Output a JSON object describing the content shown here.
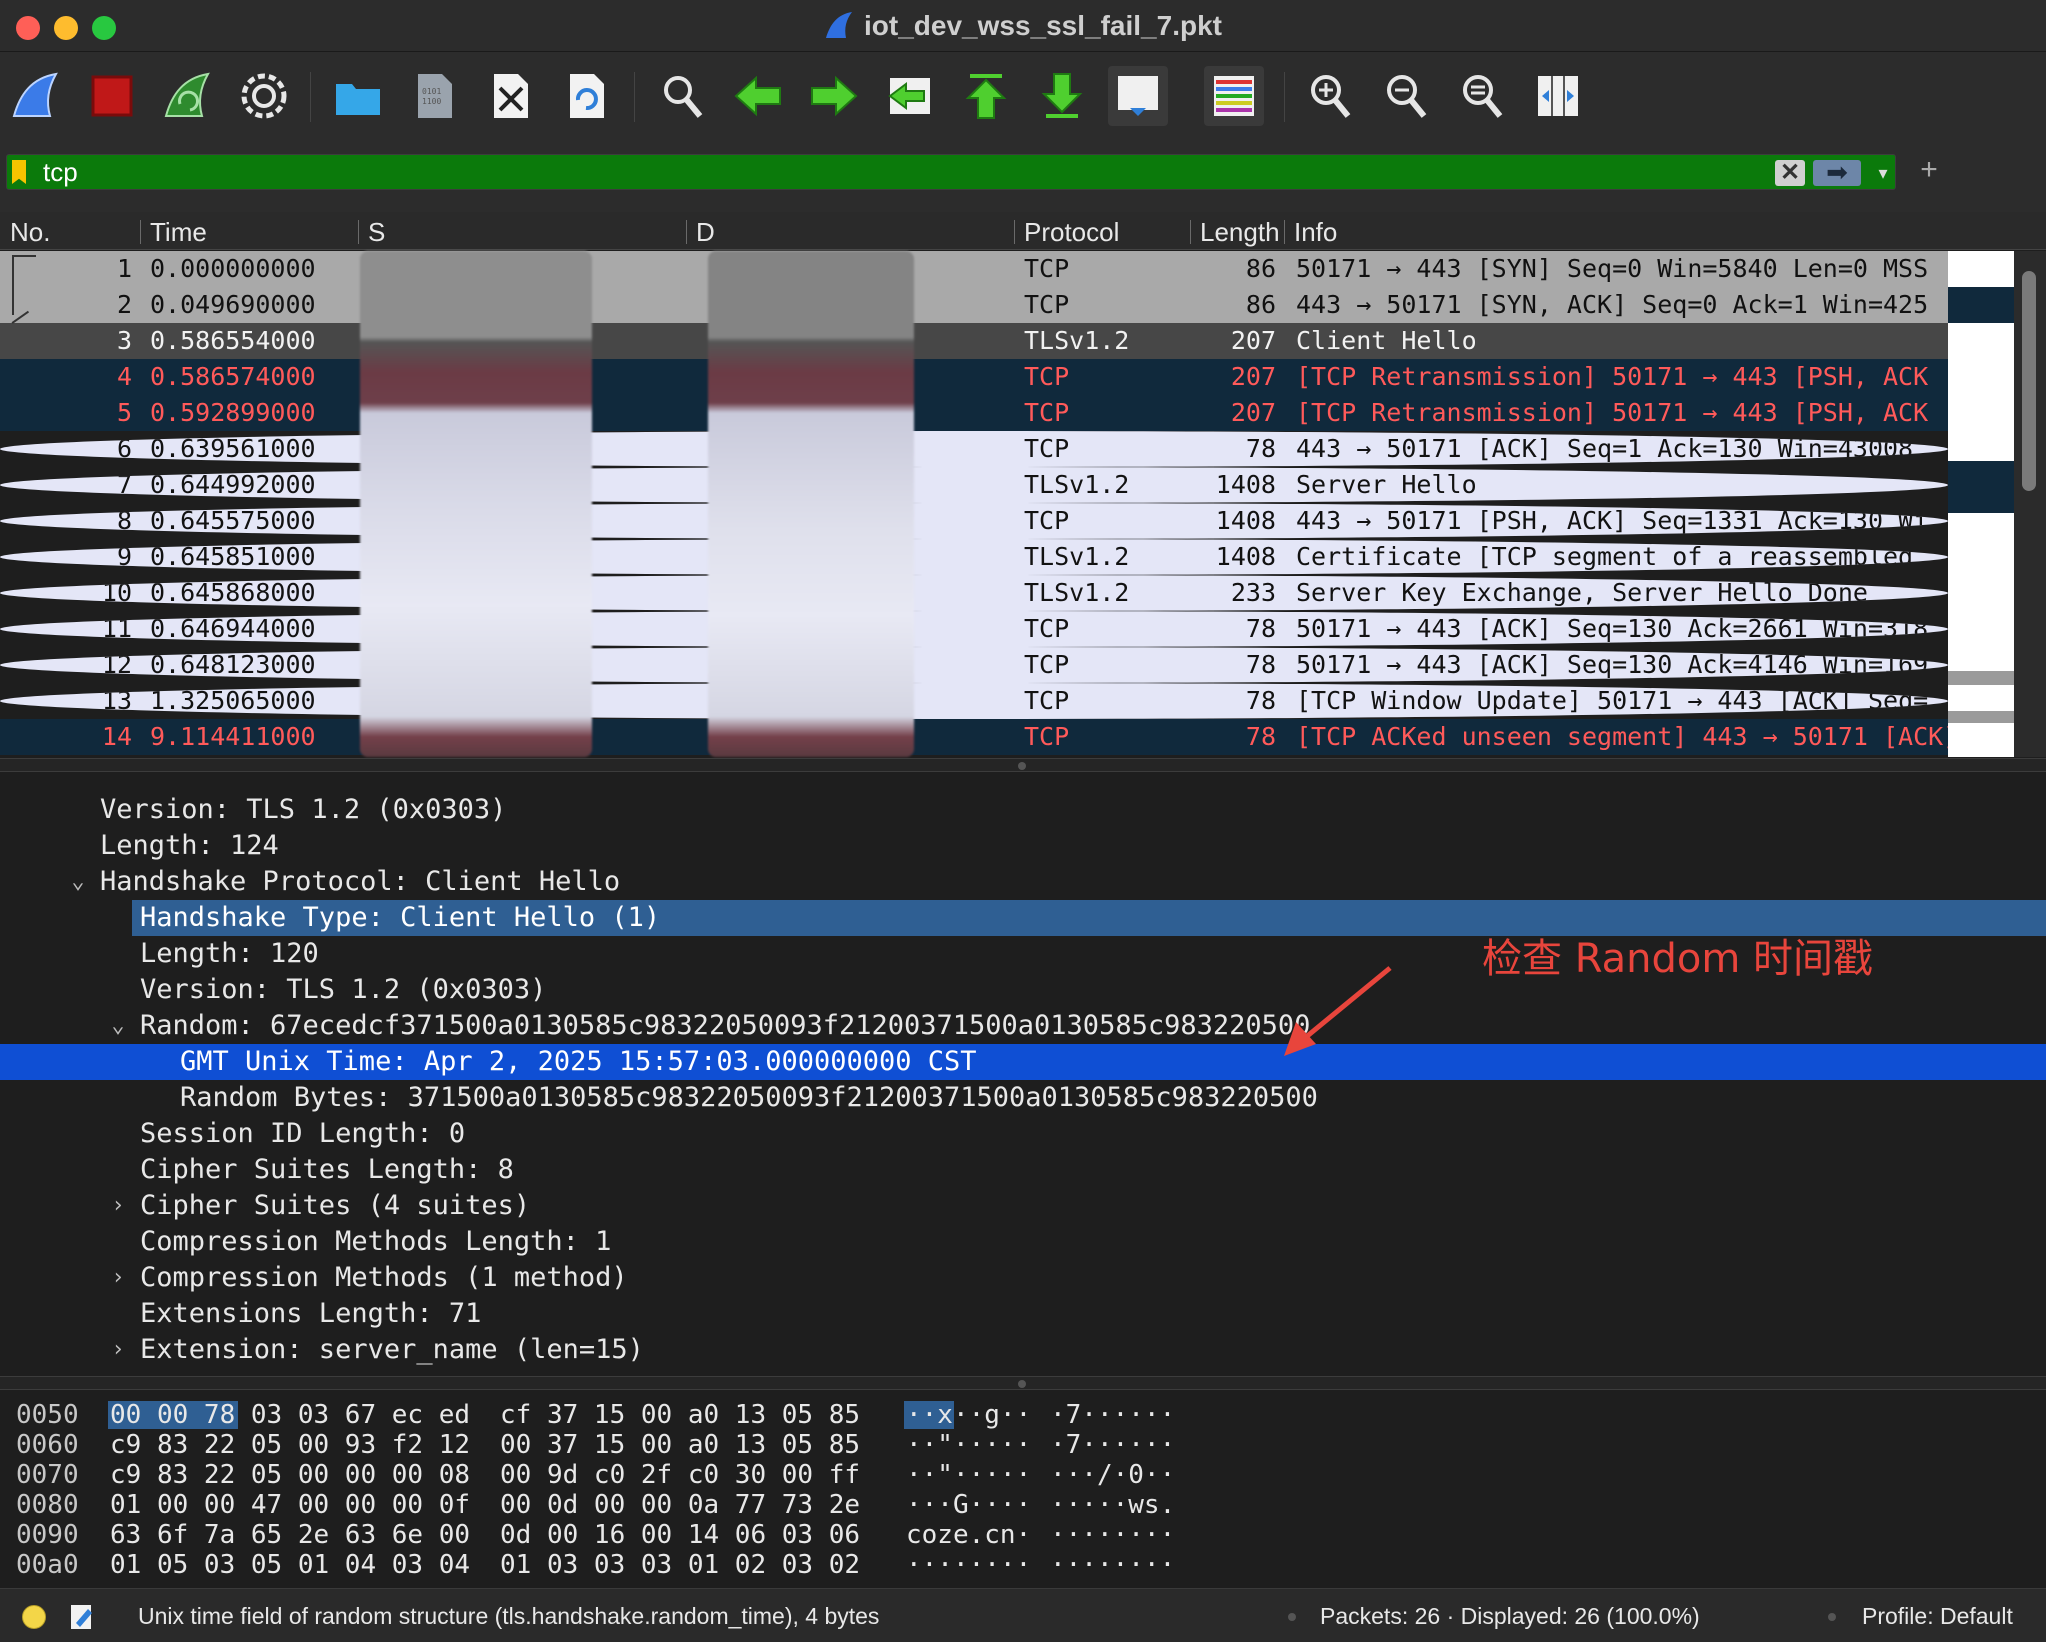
{
  "window": {
    "title": "iot_dev_wss_ssl_fail_7.pkt"
  },
  "toolbar": {
    "buttons": [
      "start-capture",
      "stop-capture",
      "restart-capture",
      "capture-options",
      "open-file",
      "save-file",
      "close-file",
      "reload-file",
      "find-packet",
      "go-back",
      "go-forward",
      "go-to-packet",
      "go-first",
      "go-last",
      "autoscroll",
      "colorize",
      "zoom-in",
      "zoom-out",
      "zoom-normal",
      "resize-columns"
    ]
  },
  "filter": {
    "value": "tcp",
    "bar_color": "#0b7a0b",
    "clear_glyph": "✕",
    "apply_glyph": "➡",
    "dropdown_glyph": "▾",
    "add_glyph": "+"
  },
  "packet_list": {
    "columns": [
      "No.",
      "Time",
      "S",
      "D",
      "Protocol",
      "Length",
      "Info"
    ],
    "rows": [
      {
        "no": "1",
        "time": "0.000000000",
        "protocol": "TCP",
        "length": "86",
        "info": "50171 → 443 [SYN] Seq=0 Win=5840 Len=0 MSS",
        "style": "gray"
      },
      {
        "no": "2",
        "time": "0.049690000",
        "protocol": "TCP",
        "length": "86",
        "info": "443 → 50171 [SYN, ACK] Seq=0 Ack=1 Win=425",
        "style": "gray"
      },
      {
        "no": "3",
        "time": "0.586554000",
        "protocol": "TLSv1.2",
        "length": "207",
        "info": "Client Hello",
        "style": "sel"
      },
      {
        "no": "4",
        "time": "0.586574000",
        "protocol": "TCP",
        "length": "207",
        "info": "[TCP Retransmission] 50171 → 443 [PSH, ACK",
        "style": "dark"
      },
      {
        "no": "5",
        "time": "0.592899000",
        "protocol": "TCP",
        "length": "207",
        "info": "[TCP Retransmission] 50171 → 443 [PSH, ACK",
        "style": "dark"
      },
      {
        "no": "6",
        "time": "0.639561000",
        "protocol": "TCP",
        "length": "78",
        "info": "443 → 50171 [ACK] Seq=1 Ack=130 Win=43008",
        "style": "light"
      },
      {
        "no": "7",
        "time": "0.644992000",
        "protocol": "TLSv1.2",
        "length": "1408",
        "info": "Server Hello",
        "style": "light"
      },
      {
        "no": "8",
        "time": "0.645575000",
        "protocol": "TCP",
        "length": "1408",
        "info": "443 → 50171 [PSH, ACK] Seq=1331 Ack=130 Wi",
        "style": "light"
      },
      {
        "no": "9",
        "time": "0.645851000",
        "protocol": "TLSv1.2",
        "length": "1408",
        "info": "Certificate [TCP segment of a reassembled",
        "style": "light"
      },
      {
        "no": "10",
        "time": "0.645868000",
        "protocol": "TLSv1.2",
        "length": "233",
        "info": "Server Key Exchange, Server Hello Done",
        "style": "light"
      },
      {
        "no": "11",
        "time": "0.646944000",
        "protocol": "TCP",
        "length": "78",
        "info": "50171 → 443 [ACK] Seq=130 Ack=2661 Win=318",
        "style": "light"
      },
      {
        "no": "12",
        "time": "0.648123000",
        "protocol": "TCP",
        "length": "78",
        "info": "50171 → 443 [ACK] Seq=130 Ack=4146 Win=169",
        "style": "light"
      },
      {
        "no": "13",
        "time": "1.325065000",
        "protocol": "TCP",
        "length": "78",
        "info": "[TCP Window Update] 50171 → 443 [ACK] Seq=",
        "style": "light"
      },
      {
        "no": "14",
        "time": "9.114411000",
        "protocol": "TCP",
        "length": "78",
        "info": "[TCP ACKed unseen segment] 443 → 50171 [ACK] Seq",
        "style": "dark"
      }
    ]
  },
  "details": {
    "rows": [
      {
        "indent": 0,
        "twisty": "",
        "text": "Version: TLS 1.2 (0x0303)",
        "style": ""
      },
      {
        "indent": 0,
        "twisty": "",
        "text": "Length: 124",
        "style": ""
      },
      {
        "indent": 0,
        "twisty": "⌄",
        "text": "Handshake Protocol: Client Hello",
        "style": ""
      },
      {
        "indent": 1,
        "twisty": "",
        "text": "Handshake Type: Client Hello (1)",
        "style": "hl"
      },
      {
        "indent": 1,
        "twisty": "",
        "text": "Length: 120",
        "style": ""
      },
      {
        "indent": 1,
        "twisty": "",
        "text": "Version: TLS 1.2 (0x0303)",
        "style": ""
      },
      {
        "indent": 1,
        "twisty": "⌄",
        "text": "Random: 67ecedcf371500a0130585c98322050093f21200371500a0130585c983220500",
        "style": ""
      },
      {
        "indent": 2,
        "twisty": "",
        "text": "GMT Unix Time: Apr  2, 2025 15:57:03.000000000 CST",
        "style": "focus"
      },
      {
        "indent": 2,
        "twisty": "",
        "text": "Random Bytes: 371500a0130585c98322050093f21200371500a0130585c983220500",
        "style": ""
      },
      {
        "indent": 1,
        "twisty": "",
        "text": "Session ID Length: 0",
        "style": ""
      },
      {
        "indent": 1,
        "twisty": "",
        "text": "Cipher Suites Length: 8",
        "style": ""
      },
      {
        "indent": 1,
        "twisty": "›",
        "text": "Cipher Suites (4 suites)",
        "style": ""
      },
      {
        "indent": 1,
        "twisty": "",
        "text": "Compression Methods Length: 1",
        "style": ""
      },
      {
        "indent": 1,
        "twisty": "›",
        "text": "Compression Methods (1 method)",
        "style": ""
      },
      {
        "indent": 1,
        "twisty": "",
        "text": "Extensions Length: 71",
        "style": ""
      },
      {
        "indent": 1,
        "twisty": "›",
        "text": "Extension: server_name (len=15)",
        "style": ""
      }
    ],
    "annotation": "检查 Random 时间戳",
    "annotation_color": "#e8453c"
  },
  "hex": {
    "rows": [
      {
        "offset": "0050",
        "bytes1": "00 00 78 03 03 67 ec ed",
        "bytes2": "cf 37 15 00 a0 13 05 85",
        "ascii1": "··x··g··",
        "ascii2": "·7······"
      },
      {
        "offset": "0060",
        "bytes1": "c9 83 22 05 00 93 f2 12",
        "bytes2": "00 37 15 00 a0 13 05 85",
        "ascii1": "··\"·····",
        "ascii2": "·7······"
      },
      {
        "offset": "0070",
        "bytes1": "c9 83 22 05 00 00 00 08",
        "bytes2": "00 9d c0 2f c0 30 00 ff",
        "ascii1": "··\"·····",
        "ascii2": "···/·0··"
      },
      {
        "offset": "0080",
        "bytes1": "01 00 00 47 00 00 00 0f",
        "bytes2": "00 0d 00 00 0a 77 73 2e",
        "ascii1": "···G····",
        "ascii2": "·····ws."
      },
      {
        "offset": "0090",
        "bytes1": "63 6f 7a 65 2e 63 6e 00",
        "bytes2": "0d 00 16 00 14 06 03 06",
        "ascii1": "coze.cn·",
        "ascii2": "········"
      },
      {
        "offset": "00a0",
        "bytes1": "01 05 03 05 01 04 03 04",
        "bytes2": "01 03 03 03 01 02 03 02",
        "ascii1": "········",
        "ascii2": "········"
      }
    ]
  },
  "status": {
    "field": "Unix time field of random structure (tls.handshake.random_time), 4 bytes",
    "packets": "Packets: 26 · Displayed: 26 (100.0%)",
    "profile": "Profile: Default"
  },
  "colors": {
    "row_gray": "#a9a9a9",
    "row_dark": "#10293c",
    "row_dark_text": "#ff5a5a",
    "row_light": "#e4e6f7",
    "selection_blue": "#0f4fd4",
    "highlight_blue": "#2f5f93"
  }
}
